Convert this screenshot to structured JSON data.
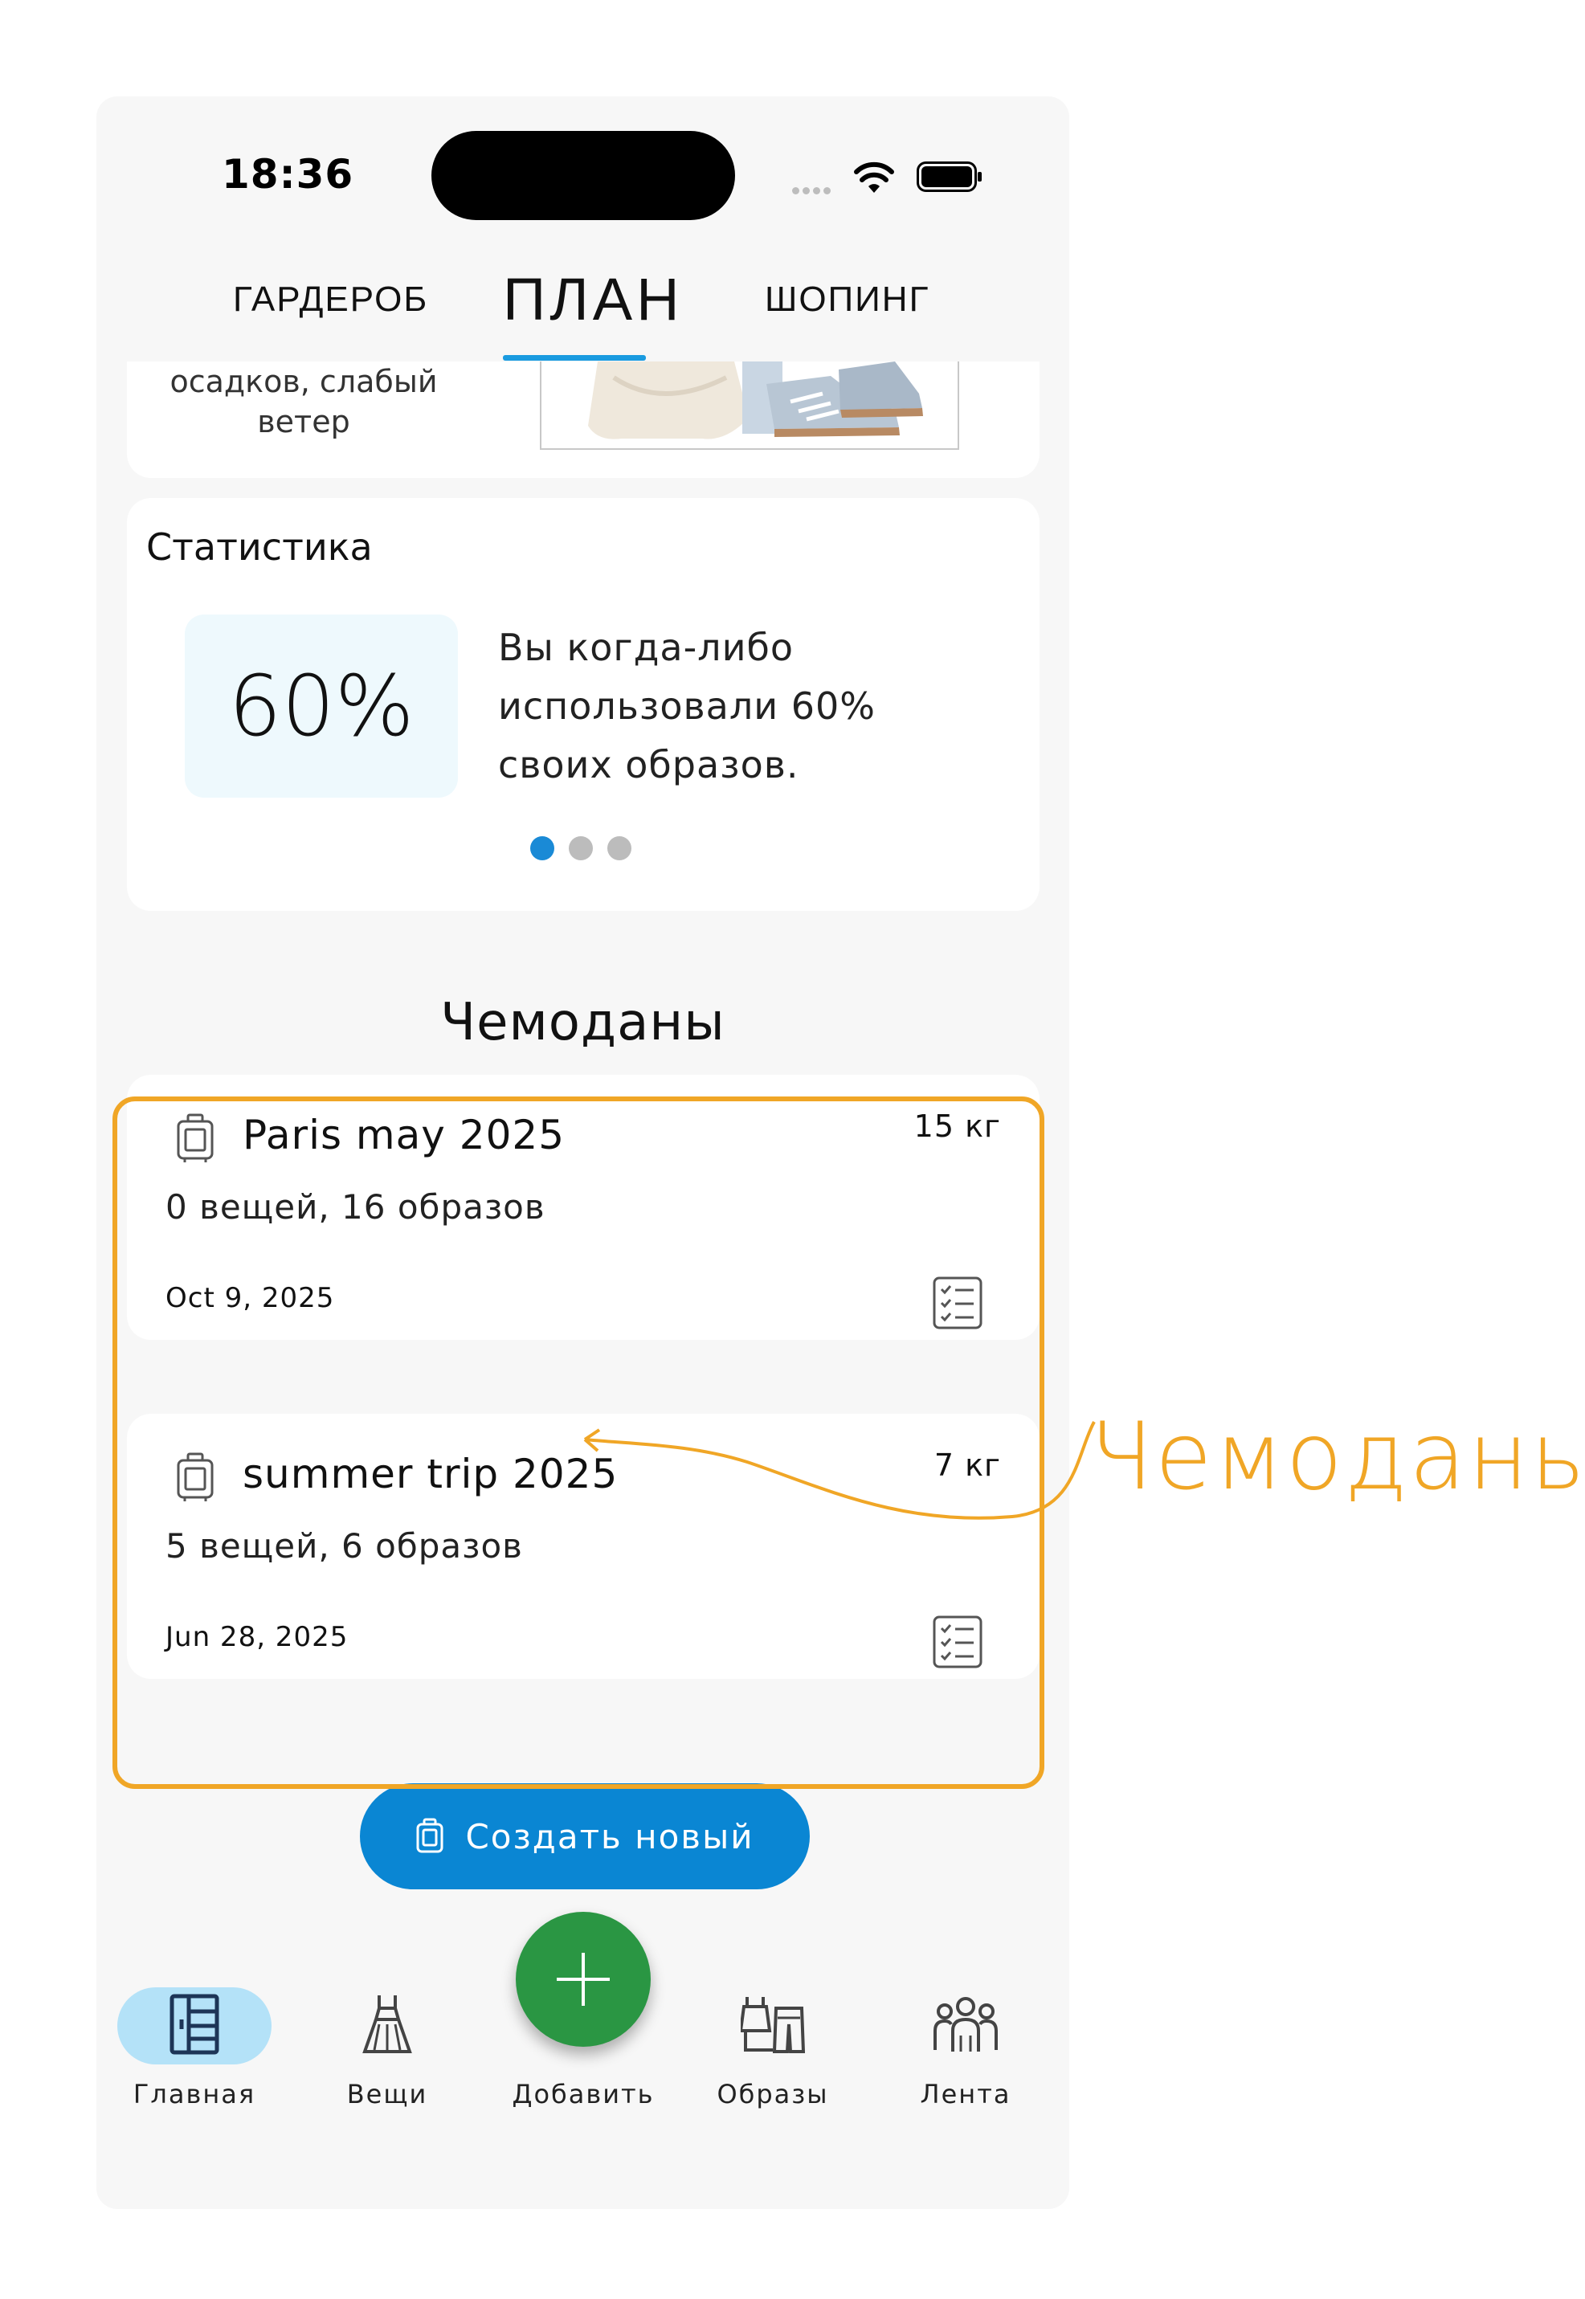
{
  "status_bar": {
    "time": "18:36"
  },
  "top_tabs": [
    {
      "label": "ГАРДЕРОБ",
      "active": false
    },
    {
      "label": "ПЛАН",
      "active": true
    },
    {
      "label": "ШОПИНГ",
      "active": false
    }
  ],
  "weather": {
    "description": "осадков, слабый\nветер"
  },
  "statistics": {
    "title": "Статистика",
    "percent": "60%",
    "description": "Вы когда-либо использовали 60% своих образов.",
    "page_count": 3,
    "active_page": 1
  },
  "suitcases": {
    "title": "Чемоданы",
    "items": [
      {
        "name": "Paris may 2025",
        "weight": "15 кг",
        "counts": "0 вещей, 16 образов",
        "date": "Oct 9, 2025"
      },
      {
        "name": "summer trip 2025",
        "weight": "7 кг",
        "counts": "5 вещей, 6 образов",
        "date": "Jun 28, 2025"
      }
    ],
    "create_label": "Создать новый"
  },
  "bottom_nav": {
    "items": [
      {
        "label": "Главная",
        "icon": "wardrobe-icon",
        "active": true
      },
      {
        "label": "Вещи",
        "icon": "dress-icon",
        "active": false
      },
      {
        "label": "Добавить",
        "icon": "plus-icon",
        "active": false
      },
      {
        "label": "Образы",
        "icon": "outfits-icon",
        "active": false
      },
      {
        "label": "Лента",
        "icon": "people-icon",
        "active": false
      }
    ]
  },
  "annotation": {
    "label": "Чемоданы"
  },
  "colors": {
    "accent": "#0a86d3",
    "tab_underline": "#1a9be0",
    "fab": "#2a9643",
    "active_nav_pill": "#b4e2f8",
    "annotation": "#f0a626",
    "stats_box": "#eef9fd"
  }
}
